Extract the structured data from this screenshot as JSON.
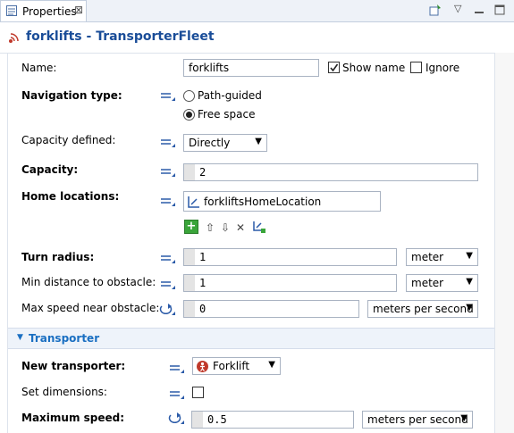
{
  "tab": {
    "title": "Properties",
    "close_glyph": "⊠"
  },
  "header": {
    "title": "forklifts - TransporterFleet"
  },
  "form": {
    "name": {
      "label": "Name:",
      "value": "forklifts",
      "show_name": "Show name",
      "ignore": "Ignore"
    },
    "navigation": {
      "label": "Navigation type:",
      "option1": "Path-guided",
      "option2": "Free space",
      "selected": "Free space"
    },
    "capacity_defined": {
      "label": "Capacity defined:",
      "value": "Directly"
    },
    "capacity": {
      "label": "Capacity:",
      "value": "2"
    },
    "home": {
      "label": "Home locations:",
      "item": "forkliftsHomeLocation"
    },
    "turn_radius": {
      "label": "Turn radius:",
      "value": "1",
      "unit": "meter"
    },
    "min_distance": {
      "label": "Min distance to obstacle:",
      "value": "1",
      "unit": "meter"
    },
    "max_speed_near": {
      "label": "Max speed near obstacle:",
      "value": "0",
      "unit": "meters per second"
    },
    "section": {
      "label": "Transporter"
    },
    "new_transporter": {
      "label": "New transporter:",
      "value": "Forklift"
    },
    "set_dimensions": {
      "label": "Set dimensions:"
    },
    "max_speed": {
      "label": "Maximum speed:",
      "value": "0.5",
      "unit": "meters per second"
    }
  }
}
